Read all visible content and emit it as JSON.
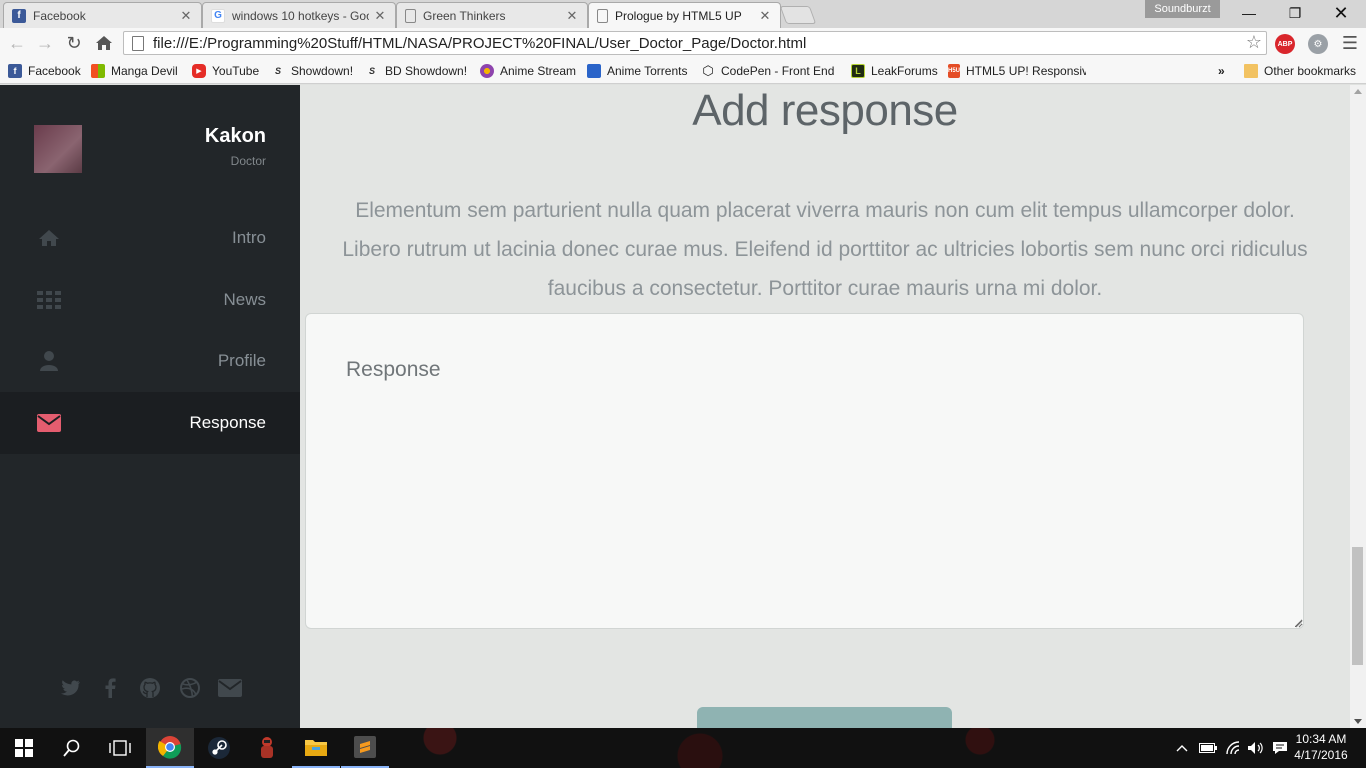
{
  "browser": {
    "tabs": [
      {
        "title": "Facebook",
        "icon": "facebook-icon",
        "active": false
      },
      {
        "title": "windows 10 hotkeys - Goo",
        "icon": "google-icon",
        "active": false
      },
      {
        "title": "Green Thinkers",
        "icon": "page-icon",
        "active": false
      },
      {
        "title": "Prologue by HTML5 UP",
        "icon": "page-icon",
        "active": true
      }
    ],
    "profile_name": "Soundburzt",
    "url": "file:///E:/Programming%20Stuff/HTML/NASA/PROJECT%20FINAL/User_Doctor_Page/Doctor.html",
    "extensions": {
      "abp": "ABP"
    },
    "bookmarks": [
      {
        "label": "Facebook",
        "icon": "facebook-icon"
      },
      {
        "label": "Manga Devil",
        "icon": "windows-logo-icon"
      },
      {
        "label": "YouTube",
        "icon": "youtube-icon"
      },
      {
        "label": "Showdown!",
        "icon": "showdown-icon"
      },
      {
        "label": "BD Showdown!",
        "icon": "showdown-icon"
      },
      {
        "label": "Anime Stream",
        "icon": "anime-stream-icon"
      },
      {
        "label": "Anime Torrents",
        "icon": "torrent-icon"
      },
      {
        "label": "CodePen - Front End",
        "icon": "codepen-icon"
      },
      {
        "label": "LeakForums",
        "icon": "leakforums-icon"
      },
      {
        "label": "HTML5 UP! Responsiv",
        "icon": "html5up-icon"
      }
    ],
    "overflow": "»",
    "other_bookmarks": "Other bookmarks"
  },
  "sidebar": {
    "user_name": "Kakon",
    "user_role": "Doctor",
    "nav": [
      {
        "label": "Intro",
        "icon": "home-icon",
        "active": false
      },
      {
        "label": "News",
        "icon": "grid-icon",
        "active": false
      },
      {
        "label": "Profile",
        "icon": "user-icon",
        "active": false
      },
      {
        "label": "Response",
        "icon": "envelope-icon",
        "active": true
      }
    ],
    "social": [
      "twitter-icon",
      "facebook-icon",
      "github-icon",
      "dribbble-icon",
      "envelope-icon"
    ]
  },
  "main": {
    "heading": "Add response",
    "intro": "Elementum sem parturient nulla quam placerat viverra mauris non cum elit tempus ullamcorper dolor. Libero rutrum ut lacinia donec curae mus. Eleifend id porttitor ac ultricies lobortis sem nunc orci ridiculus faucibus a consectetur. Porttitor curae mauris urna mi dolor.",
    "response_placeholder": "Response",
    "response_value": ""
  },
  "taskbar": {
    "time": "10:34 AM",
    "date": "4/17/2016"
  },
  "colors": {
    "sidebar_bg": "#222629",
    "sidebar_active_bg": "#1b1e21",
    "active_icon": "#e45d6f",
    "main_bg": "#e3e5e3",
    "button": "#8fb3b2"
  }
}
